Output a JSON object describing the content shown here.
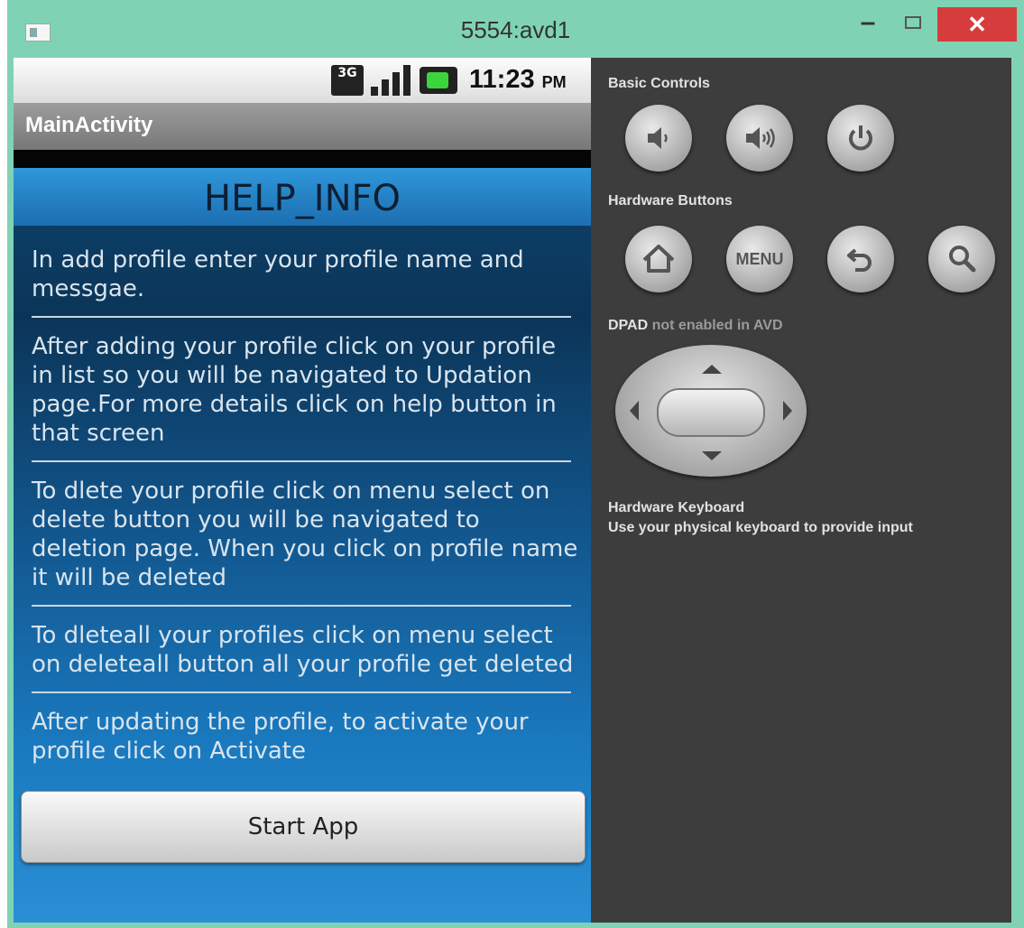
{
  "window": {
    "title": "5554:avd1",
    "minimize_glyph": "–",
    "close_glyph": "✕"
  },
  "statusbar": {
    "network_label": "3G",
    "time": "11:23",
    "ampm": "PM"
  },
  "app": {
    "activity_title": "MainActivity",
    "header": "HELP_INFO",
    "paragraphs": [
      "In add profile enter your profile name and messgae.",
      "After adding your profile click on your profile in list so you will be navigated to Updation page.For more details click on help button in that screen",
      "To dlete your profile click on menu select on delete button you will be navigated to deletion page. When you click on profile name it will be deleted",
      "To dleteall your profiles click on menu select on deleteall button all your profile get deleted",
      "After updating the profile, to activate your profile click on Activate"
    ],
    "start_button": "Start App"
  },
  "panel": {
    "basic_controls_label": "Basic Controls",
    "hardware_buttons_label": "Hardware Buttons",
    "menu_button": "MENU",
    "dpad_label": "DPAD",
    "dpad_note": "not enabled in AVD",
    "keyboard_label": "Hardware Keyboard",
    "keyboard_note": "Use your physical keyboard to provide input"
  },
  "colors": {
    "frame": "#7fd3b4",
    "close_button": "#d63c3c",
    "panel_bg": "#3d3d3d",
    "screen_blue": "#12568d"
  }
}
